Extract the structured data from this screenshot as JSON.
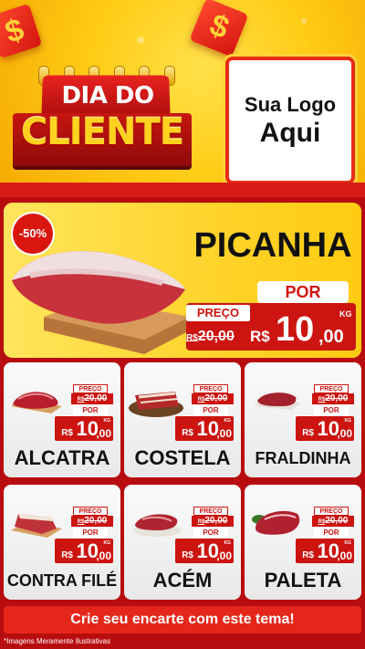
{
  "header": {
    "title_line1": "DIA DO",
    "title_line2": "CLIENTE",
    "logo_line1": "Sua Logo",
    "logo_line2": "Aqui",
    "dollar_symbol": "$"
  },
  "featured": {
    "discount": "-50%",
    "name": "PICANHA",
    "por_label": "POR",
    "preco_label": "PREÇO",
    "old_currency": "R$",
    "old_price": "20,00",
    "new_currency": "R$",
    "new_int": "10",
    "new_dec": ",00",
    "unit": "KG"
  },
  "products": [
    {
      "name": "ALCATRA",
      "preco_label": "PREÇO",
      "old_currency": "R$",
      "old_price": "20,00",
      "por_label": "POR",
      "new_currency": "R$",
      "new_int": "10",
      "new_dec": ",00",
      "unit": "KG"
    },
    {
      "name": "COSTELA",
      "preco_label": "PREÇO",
      "old_currency": "R$",
      "old_price": "20,00",
      "por_label": "POR",
      "new_currency": "R$",
      "new_int": "10",
      "new_dec": ",00",
      "unit": "KG"
    },
    {
      "name": "FRALDINHA",
      "preco_label": "PREÇO",
      "old_currency": "R$",
      "old_price": "20,00",
      "por_label": "POR",
      "new_currency": "R$",
      "new_int": "10",
      "new_dec": ",00",
      "unit": "KG"
    },
    {
      "name": "CONTRA FILÉ",
      "preco_label": "PREÇO",
      "old_currency": "R$",
      "old_price": "20,00",
      "por_label": "POR",
      "new_currency": "R$",
      "new_int": "10",
      "new_dec": ",00",
      "unit": "KG"
    },
    {
      "name": "ACÉM",
      "preco_label": "PREÇO",
      "old_currency": "R$",
      "old_price": "20,00",
      "por_label": "POR",
      "new_currency": "R$",
      "new_int": "10",
      "new_dec": ",00",
      "unit": "KG"
    },
    {
      "name": "PALETA",
      "preco_label": "PREÇO",
      "old_currency": "R$",
      "old_price": "20,00",
      "por_label": "POR",
      "new_currency": "R$",
      "new_int": "10",
      "new_dec": ",00",
      "unit": "KG"
    }
  ],
  "footer": {
    "cta": "Crie seu encarte com este tema!",
    "disclaimer": "*Imagens Meramente Ilustrativas"
  },
  "colors": {
    "brand_red": "#cc1410",
    "brand_yellow": "#ffd32a",
    "background_red": "#b80d10"
  },
  "icons": {
    "dollar_cube": "dollar-cube-icon"
  }
}
